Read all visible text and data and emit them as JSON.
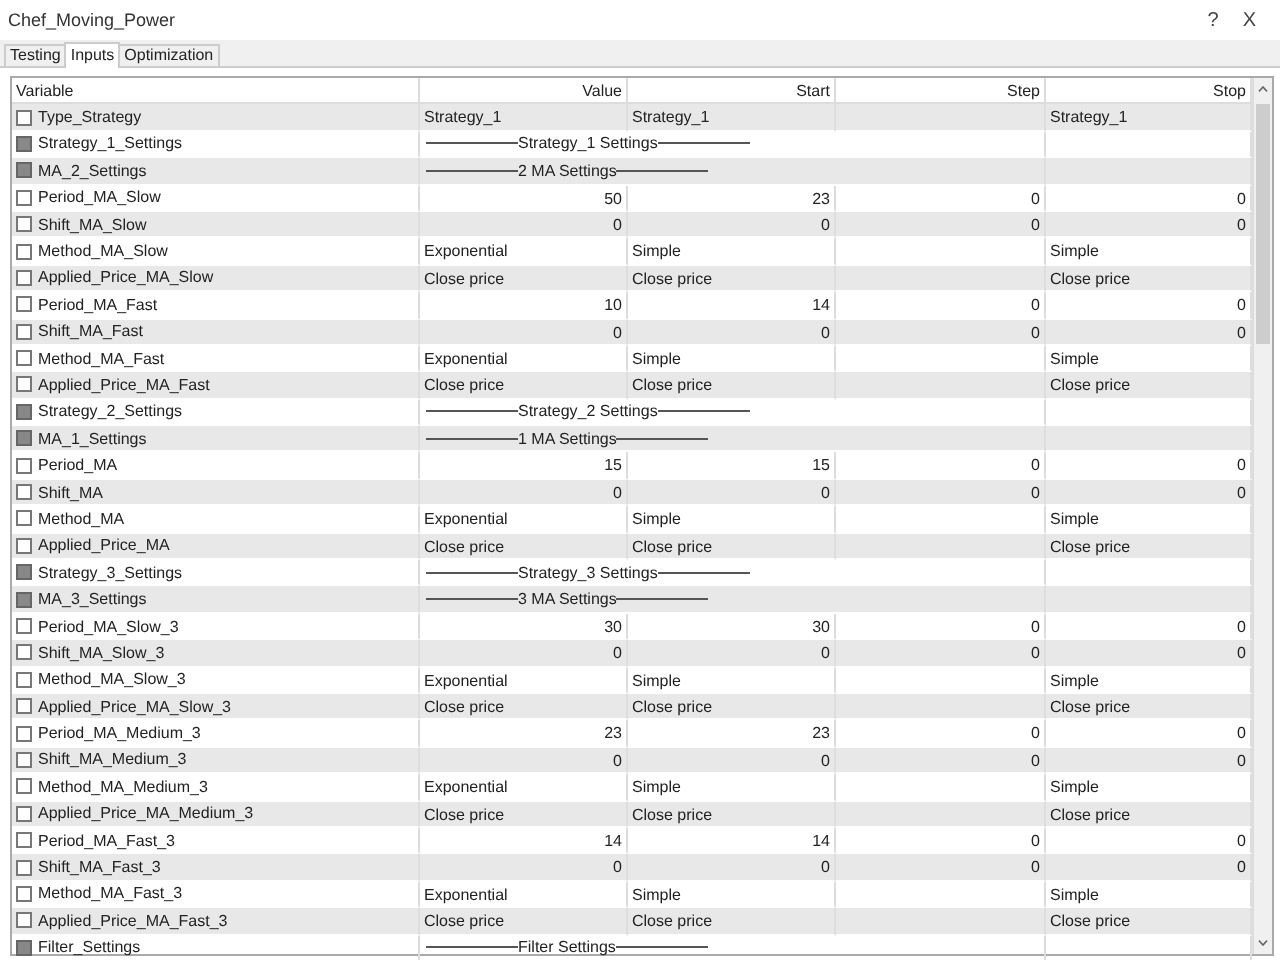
{
  "window": {
    "title": "Chef_Moving_Power",
    "help": "?",
    "close": "X"
  },
  "tabs": [
    {
      "label": "Testing",
      "selected": false
    },
    {
      "label": "Inputs",
      "selected": true
    },
    {
      "label": "Optimization",
      "selected": false
    }
  ],
  "table": {
    "columns": [
      "Variable",
      "Value",
      "Start",
      "Step",
      "Stop"
    ],
    "rows": [
      {
        "kind": "enum",
        "name": "Type_Strategy",
        "checked": false,
        "value": "Strategy_1",
        "start": "Strategy_1",
        "stop": "Strategy_1"
      },
      {
        "kind": "separator",
        "name": "Strategy_1_Settings",
        "checked": false,
        "value": "Strategy_1 Settings"
      },
      {
        "kind": "separator",
        "name": "MA_2_Settings",
        "checked": false,
        "value": "2 MA Settings"
      },
      {
        "kind": "number",
        "name": "Period_MA_Slow",
        "checked": false,
        "value": "50",
        "start": "23",
        "step": "0",
        "stop": "0"
      },
      {
        "kind": "number",
        "name": "Shift_MA_Slow",
        "checked": false,
        "value": "0",
        "start": "0",
        "step": "0",
        "stop": "0"
      },
      {
        "kind": "enum",
        "name": "Method_MA_Slow",
        "checked": false,
        "value": "Exponential",
        "start": "Simple",
        "stop": "Simple"
      },
      {
        "kind": "enum",
        "name": "Applied_Price_MA_Slow",
        "checked": false,
        "value": "Close price",
        "start": "Close price",
        "stop": "Close price"
      },
      {
        "kind": "number",
        "name": "Period_MA_Fast",
        "checked": false,
        "value": "10",
        "start": "14",
        "step": "0",
        "stop": "0"
      },
      {
        "kind": "number",
        "name": "Shift_MA_Fast",
        "checked": false,
        "value": "0",
        "start": "0",
        "step": "0",
        "stop": "0"
      },
      {
        "kind": "enum",
        "name": "Method_MA_Fast",
        "checked": false,
        "value": "Exponential",
        "start": "Simple",
        "stop": "Simple"
      },
      {
        "kind": "enum",
        "name": "Applied_Price_MA_Fast",
        "checked": false,
        "value": "Close price",
        "start": "Close price",
        "stop": "Close price"
      },
      {
        "kind": "separator",
        "name": "Strategy_2_Settings",
        "checked": false,
        "value": "Strategy_2 Settings"
      },
      {
        "kind": "separator",
        "name": "MA_1_Settings",
        "checked": false,
        "value": "1 MA Settings"
      },
      {
        "kind": "number",
        "name": "Period_MA",
        "checked": false,
        "value": "15",
        "start": "15",
        "step": "0",
        "stop": "0"
      },
      {
        "kind": "number",
        "name": "Shift_MA",
        "checked": false,
        "value": "0",
        "start": "0",
        "step": "0",
        "stop": "0"
      },
      {
        "kind": "enum",
        "name": "Method_MA",
        "checked": false,
        "value": "Exponential",
        "start": "Simple",
        "stop": "Simple"
      },
      {
        "kind": "enum",
        "name": "Applied_Price_MA",
        "checked": false,
        "value": "Close price",
        "start": "Close price",
        "stop": "Close price"
      },
      {
        "kind": "separator",
        "name": "Strategy_3_Settings",
        "checked": false,
        "value": "Strategy_3 Settings"
      },
      {
        "kind": "separator",
        "name": "MA_3_Settings",
        "checked": false,
        "value": "3 MA Settings"
      },
      {
        "kind": "number",
        "name": "Period_MA_Slow_3",
        "checked": false,
        "value": "30",
        "start": "30",
        "step": "0",
        "stop": "0"
      },
      {
        "kind": "number",
        "name": "Shift_MA_Slow_3",
        "checked": false,
        "value": "0",
        "start": "0",
        "step": "0",
        "stop": "0"
      },
      {
        "kind": "enum",
        "name": "Method_MA_Slow_3",
        "checked": false,
        "value": "Exponential",
        "start": "Simple",
        "stop": "Simple"
      },
      {
        "kind": "enum",
        "name": "Applied_Price_MA_Slow_3",
        "checked": false,
        "value": "Close price",
        "start": "Close price",
        "stop": "Close price"
      },
      {
        "kind": "number",
        "name": "Period_MA_Medium_3",
        "checked": false,
        "value": "23",
        "start": "23",
        "step": "0",
        "stop": "0"
      },
      {
        "kind": "number",
        "name": "Shift_MA_Medium_3",
        "checked": false,
        "value": "0",
        "start": "0",
        "step": "0",
        "stop": "0"
      },
      {
        "kind": "enum",
        "name": "Method_MA_Medium_3",
        "checked": false,
        "value": "Exponential",
        "start": "Simple",
        "stop": "Simple"
      },
      {
        "kind": "enum",
        "name": "Applied_Price_MA_Medium_3",
        "checked": false,
        "value": "Close price",
        "start": "Close price",
        "stop": "Close price"
      },
      {
        "kind": "number",
        "name": "Period_MA_Fast_3",
        "checked": false,
        "value": "14",
        "start": "14",
        "step": "0",
        "stop": "0"
      },
      {
        "kind": "number",
        "name": "Shift_MA_Fast_3",
        "checked": false,
        "value": "0",
        "start": "0",
        "step": "0",
        "stop": "0"
      },
      {
        "kind": "enum",
        "name": "Method_MA_Fast_3",
        "checked": false,
        "value": "Exponential",
        "start": "Simple",
        "stop": "Simple"
      },
      {
        "kind": "enum",
        "name": "Applied_Price_MA_Fast_3",
        "checked": false,
        "value": "Close price",
        "start": "Close price",
        "stop": "Close price"
      },
      {
        "kind": "separator",
        "name": "Filter_Settings",
        "checked": false,
        "value": "Filter Settings"
      }
    ]
  }
}
